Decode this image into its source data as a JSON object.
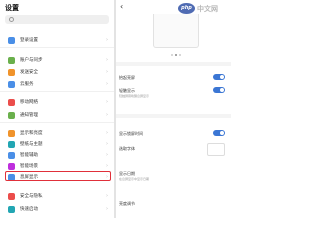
{
  "left": {
    "title": "设置",
    "items": [
      {
        "label": "登录设置",
        "color": "#4a8fe7"
      },
      {
        "label": "账户与同步",
        "color": "#6ab04c"
      },
      {
        "label": "发送安全",
        "color": "#f0932b"
      },
      {
        "label": "云服务",
        "color": "#4a8fe7"
      },
      {
        "label": "移动网络",
        "color": "#eb4d4b"
      },
      {
        "label": "通知管理",
        "color": "#6ab04c"
      },
      {
        "label": "显示和亮度",
        "color": "#f0932b"
      },
      {
        "label": "壁纸与主题",
        "color": "#22a6b3"
      },
      {
        "label": "智能辅助",
        "color": "#4a8fe7"
      },
      {
        "label": "智能场景",
        "color": "#be2edd"
      },
      {
        "label": "应用管理",
        "color": "#6ab04c"
      },
      {
        "label": "手势操作",
        "color": "#f0932b"
      },
      {
        "label": "息屏显示",
        "color": "#4a8fe7"
      },
      {
        "label": "安全与隐私",
        "color": "#eb4d4b"
      },
      {
        "label": "快速启动",
        "color": "#22a6b3"
      }
    ]
  },
  "right": {
    "rows": [
      {
        "label": "抬起亮屏",
        "toggle": true
      },
      {
        "label": "轻触显示",
        "sub": "轻触屏幕唤醒息屏显示",
        "toggle": true
      },
      {
        "label": "显示锁屏时间",
        "toggle": true
      },
      {
        "label": "选取字体",
        "toggle": false
      },
      {
        "label": "显示日期",
        "sub": "在息屏显示中显示日期",
        "toggle": false
      },
      {
        "label": "亮度调节",
        "toggle": false
      }
    ]
  },
  "watermark": {
    "badge": "php",
    "text": "中文网"
  }
}
